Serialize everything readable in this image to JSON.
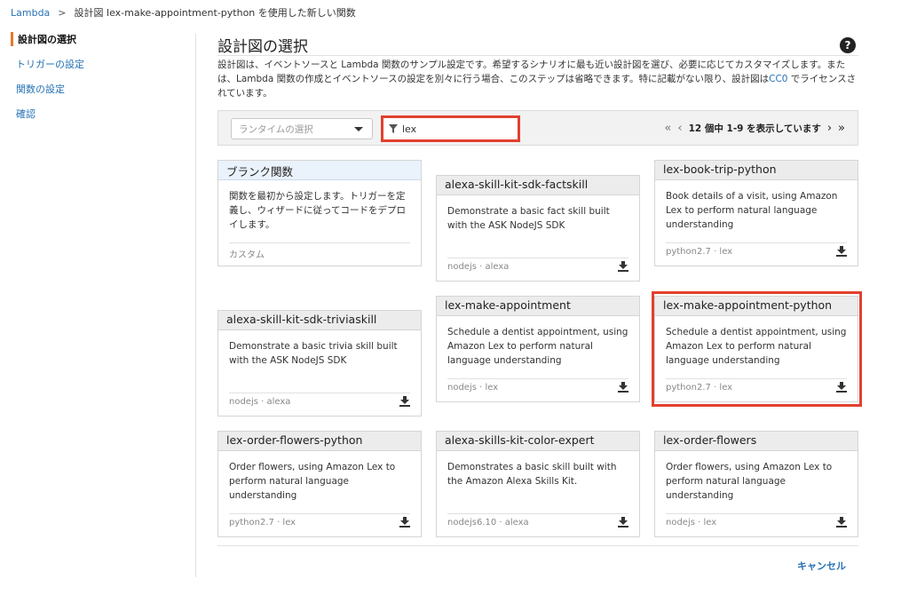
{
  "breadcrumb": {
    "root": "Lambda",
    "separator": ">",
    "current": "設計図 lex-make-appointment-python を使用した新しい関数"
  },
  "sidebar": {
    "items": [
      {
        "label": "設計図の選択",
        "active": true
      },
      {
        "label": "トリガーの設定",
        "active": false
      },
      {
        "label": "関数の設定",
        "active": false
      },
      {
        "label": "確認",
        "active": false
      }
    ]
  },
  "page": {
    "title": "設計図の選択",
    "help_icon": "question-circle-icon",
    "description_1": "設計図は、イベントソースと Lambda 関数のサンプル設定です。希望するシナリオに最も近い設計図を選び、必要に応じてカスタマイズします。または、Lambda 関数の作成とイベントソースの設定を別々に行う場合、このステップは省略できます。特に記載がない限り、設計図は",
    "description_link": "CC0",
    "description_2": " でライセンスされています。"
  },
  "filter": {
    "runtime_placeholder": "ランタイムの選択",
    "search_value": "lex",
    "search_icon": "filter-icon",
    "pager_first": "«",
    "pager_prev": "‹",
    "pager_text": "12 個中 1-9 を表示しています",
    "pager_next": "›",
    "pager_last": "»"
  },
  "cards": [
    {
      "title": "ブランク関数",
      "description": "関数を最初から設定します。トリガーを定義し、ウィザードに従ってコードをデプロイします。",
      "tags": "カスタム"
    },
    {
      "title": "alexa-skill-kit-sdk-factskill",
      "description": "Demonstrate a basic fact skill built with the ASK NodeJS SDK",
      "tags": "nodejs · alexa"
    },
    {
      "title": "lex-book-trip-python",
      "description": "Book details of a visit, using Amazon Lex to perform natural language understanding",
      "tags": "python2.7 · lex"
    },
    {
      "title": "alexa-skill-kit-sdk-triviaskill",
      "description": "Demonstrate a basic trivia skill built with the ASK NodeJS SDK",
      "tags": "nodejs · alexa"
    },
    {
      "title": "lex-make-appointment",
      "description": "Schedule a dentist appointment, using Amazon Lex to perform natural language understanding",
      "tags": "nodejs · lex"
    },
    {
      "title": "lex-make-appointment-python",
      "description": "Schedule a dentist appointment, using Amazon Lex to perform natural language understanding",
      "tags": "python2.7 · lex"
    },
    {
      "title": "lex-order-flowers-python",
      "description": "Order flowers, using Amazon Lex to perform natural language understanding",
      "tags": "python2.7 · lex"
    },
    {
      "title": "alexa-skills-kit-color-expert",
      "description": "Demonstrates a basic skill built with the Amazon Alexa Skills Kit.",
      "tags": "nodejs6.10 · alexa"
    },
    {
      "title": "lex-order-flowers",
      "description": "Order flowers, using Amazon Lex to perform natural language understanding",
      "tags": "nodejs · lex"
    }
  ],
  "download_icon": "download-icon",
  "footer": {
    "cancel_label": "キャンセル"
  },
  "colors": {
    "link": "#2672b6",
    "highlight": "#e2402f",
    "active_marker": "#e8782a"
  }
}
